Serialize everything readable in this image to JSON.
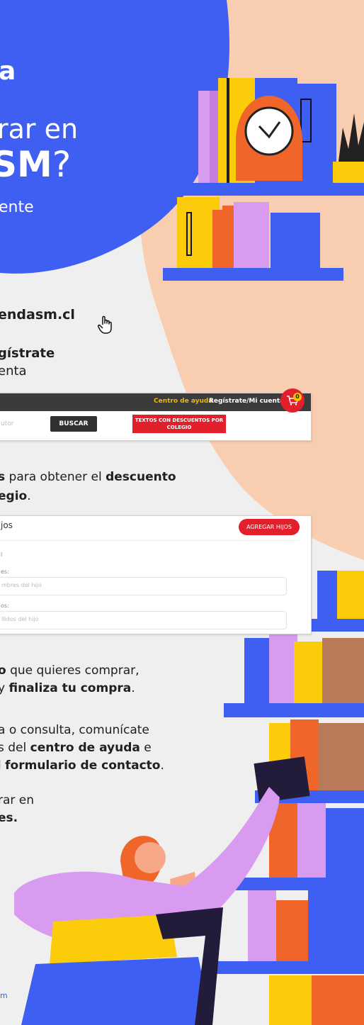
{
  "hero": {
    "line1": "a",
    "line2": "rar en",
    "line3": "SM",
    "line3_mark": "?",
    "line4": "ente"
  },
  "step1": {
    "domain": "endasm.cl"
  },
  "step2": {
    "bold": "gístrate",
    "rest": "enta"
  },
  "shop_header": {
    "help_label": "Centro de ayuda",
    "account_label": "Regístrate/Mi cuenta",
    "cart_count": "0",
    "search_placeholder": "utor",
    "search_button": "BUSCAR",
    "discount_button": "TEXTOS CON DESCUENTOS POR COLEGIO"
  },
  "step3": {
    "l1_bold_a": "s",
    "l1_mid": " para obtener el ",
    "l1_bold_b": "descuento",
    "l2_bold": "egio",
    "l2_end": "."
  },
  "children_form": {
    "title": "jos",
    "add_button": "AGREGAR HIJOS",
    "small_mark": "l",
    "names_label": "es:",
    "names_placeholder": "mbres del hijo",
    "surnames_label": "os:",
    "surnames_placeholder": "llidos del hijo"
  },
  "step4": {
    "l1_bold": "o",
    "l1_rest": " que quieres comprar,",
    "l2_pre": " y ",
    "l2_bold": "finaliza tu compra",
    "l2_end": "."
  },
  "step5": {
    "l1": "a o consulta, comunícate",
    "l2_pre": "s del ",
    "l2_bold": "centro de ayuda",
    "l2_post": " e",
    "l3_pre": "l ",
    "l3_bold": "formulario de contacto",
    "l3_end": "."
  },
  "step6": {
    "l1": "rar en",
    "l2_bold": "es."
  },
  "footer": {
    "text": "m"
  },
  "colors": {
    "blue": "#3f5ef2",
    "peach": "#f9cdb0",
    "red": "#e21f2a",
    "yellow": "#fccb0a",
    "lilac": "#d89bef"
  }
}
